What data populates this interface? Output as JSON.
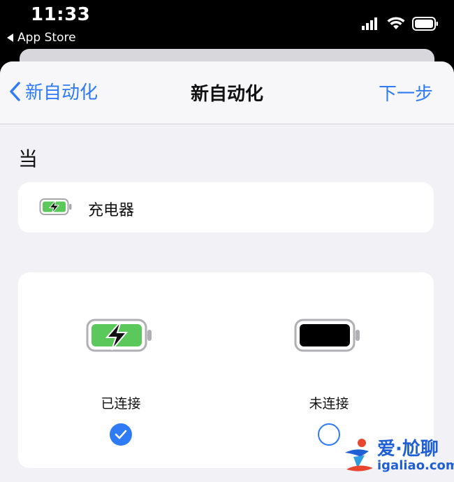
{
  "status_bar": {
    "time": "11:33",
    "back_app": "App Store"
  },
  "nav": {
    "back_label": "新自动化",
    "title": "新自动化",
    "next_label": "下一步"
  },
  "section": {
    "title": "当"
  },
  "trigger": {
    "label": "充电器",
    "icon": "battery-charging-icon"
  },
  "options": [
    {
      "label": "已连接",
      "icon": "battery-charging-icon",
      "selected": true
    },
    {
      "label": "未连接",
      "icon": "battery-full-icon",
      "selected": false
    }
  ],
  "watermark": {
    "brand": "爱·尬聊",
    "domain": "igaliao.com"
  },
  "colors": {
    "accent": "#2f7bf5",
    "battery_green": "#5ac85a",
    "sheet_bg": "#f2f2f6"
  }
}
